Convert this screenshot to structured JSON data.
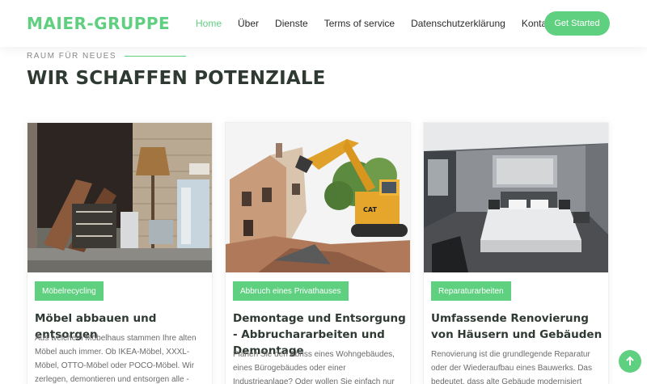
{
  "header": {
    "logo": "MAIER-GRUPPE",
    "nav": [
      "Home",
      "Über",
      "Dienste",
      "Terms of service",
      "Datenschutzerklärung",
      "Kontakte"
    ],
    "cta": "Get Started"
  },
  "section": {
    "kicker": "RAUM FÜR NEUES",
    "title": "WIR SCHAFFEN POTENZIALE"
  },
  "cards": [
    {
      "tag": "Möbelrecycling",
      "title": "Möbel abbauen und entsorgen",
      "text": "Aus welchem Möbelhaus stammen Ihre alten Möbel auch immer. Ob IKEA-Möbel, XXXL-Möbel, OTTO-Möbel oder POCO-Möbel. Wir zerlegen, demontieren und entsorgen alle - Privatmöbel -"
    },
    {
      "tag": "Abbruch eines Privathauses",
      "title": "Demontage und Entsorgung - Abbruchararbeiten und Demontage",
      "text": "Planen Sie den Abriss eines Wohngebäudes, eines Bürogebäudes oder einer Industrieanlage? Oder wollen Sie einfach nur ein Gartenhaus oder"
    },
    {
      "tag": "Reparaturarbeiten",
      "title": "Umfassende Renovierung von Häusern und Gebäuden",
      "text": "Renovierung ist die grundlegende Reparatur oder der Wiederaufbau eines Bauwerks. Das bedeutet, dass alte Gebäude modernisiert werden, z. B."
    }
  ],
  "icons": {
    "scroll_top": "arrow-up-icon"
  },
  "colors": {
    "accent": "#5fcf80",
    "heading": "#2f3a33"
  }
}
